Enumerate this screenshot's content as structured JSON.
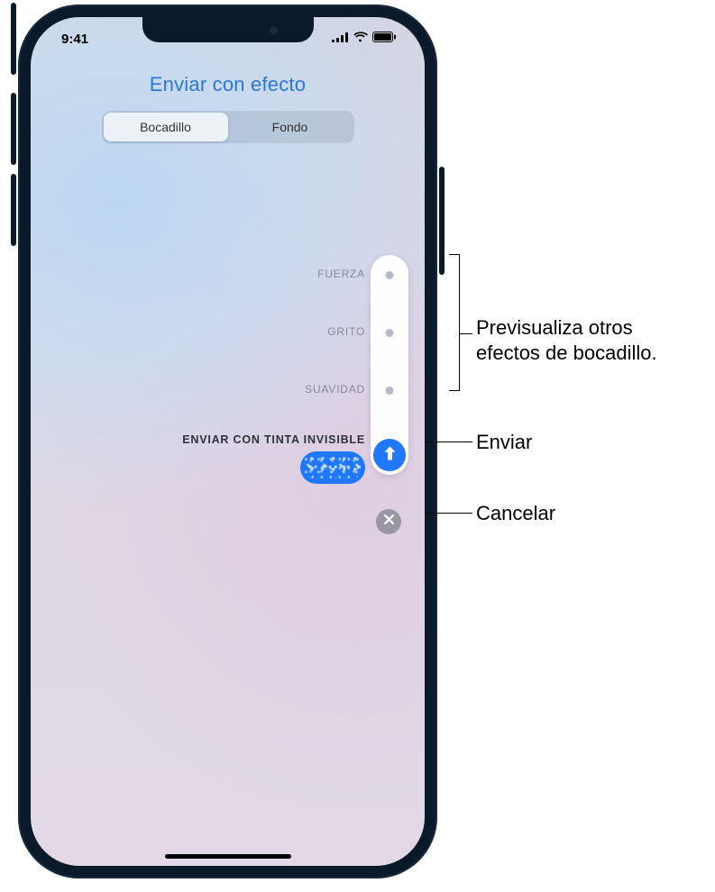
{
  "status": {
    "time": "9:41"
  },
  "header": {
    "title": "Enviar con efecto"
  },
  "segments": {
    "bubble": "Bocadillo",
    "screen": "Fondo"
  },
  "effects": {
    "slam": "FUERZA",
    "loud": "GRITO",
    "gentle": "SUAVIDAD",
    "invisible_ink": "ENVIAR CON TINTA INVISIBLE"
  },
  "callouts": {
    "preview": "Previsualiza otros efectos de bocadillo.",
    "send": "Enviar",
    "cancel": "Cancelar"
  }
}
